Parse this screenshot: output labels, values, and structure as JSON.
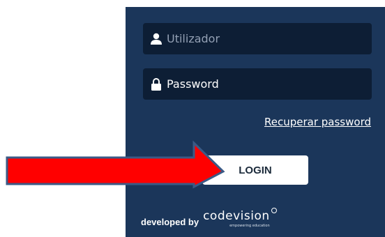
{
  "login_form": {
    "username": {
      "placeholder": "Utilizador",
      "icon": "user-icon"
    },
    "password": {
      "value": "Password",
      "icon": "lock-icon"
    },
    "recover_link": "Recuperar password",
    "login_button": "LOGIN"
  },
  "footer": {
    "developed_by": "developed by",
    "brand_name": "codevision",
    "brand_tagline": "empowering education"
  },
  "annotation": {
    "arrow_color": "#ff0000",
    "arrow_outline": "#3b5a86"
  },
  "colors": {
    "panel": "#1b365a",
    "field": "#0d1e35",
    "accent": "#ffffff"
  }
}
